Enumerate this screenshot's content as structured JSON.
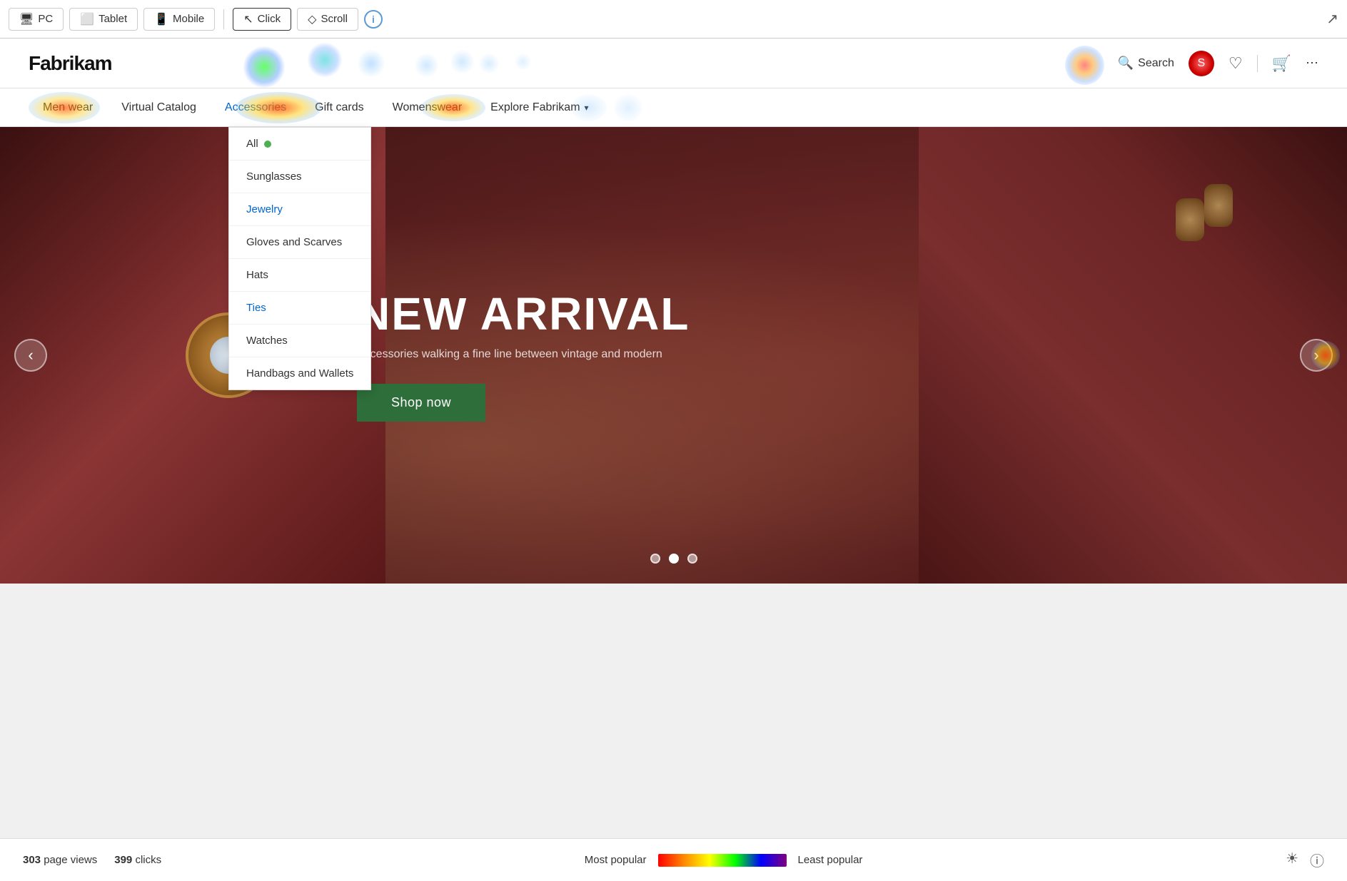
{
  "toolbar": {
    "buttons": [
      {
        "id": "pc",
        "icon": "🖥",
        "label": "PC"
      },
      {
        "id": "tablet",
        "icon": "📱",
        "label": "Tablet"
      },
      {
        "id": "mobile",
        "icon": "📱",
        "label": "Mobile"
      }
    ],
    "click_label": "Click",
    "scroll_label": "Scroll",
    "share_icon": "↗"
  },
  "site": {
    "logo": "Fabrikam",
    "search_label": "Search",
    "nav_items": [
      {
        "id": "menswear",
        "label": "Men wear",
        "active": false,
        "has_dropdown": false
      },
      {
        "id": "virtual-catalog",
        "label": "Virtual Catalog",
        "active": false,
        "has_dropdown": false
      },
      {
        "id": "accessories",
        "label": "Accessories",
        "active": true,
        "has_dropdown": false
      },
      {
        "id": "gift-cards",
        "label": "Gift cards",
        "active": false,
        "has_dropdown": false
      },
      {
        "id": "womenswear",
        "label": "Womenswear",
        "active": false,
        "has_dropdown": false
      },
      {
        "id": "explore",
        "label": "Explore Fabrikam",
        "active": false,
        "has_dropdown": true
      }
    ],
    "dropdown": {
      "items": [
        {
          "id": "all",
          "label": "All",
          "highlighted": false
        },
        {
          "id": "sunglasses",
          "label": "Sunglasses",
          "highlighted": false
        },
        {
          "id": "jewelry",
          "label": "Jewelry",
          "highlighted": true
        },
        {
          "id": "gloves-scarves",
          "label": "Gloves and Scarves",
          "highlighted": false
        },
        {
          "id": "hats",
          "label": "Hats",
          "highlighted": false
        },
        {
          "id": "ties",
          "label": "Ties",
          "highlighted": true
        },
        {
          "id": "watches",
          "label": "Watches",
          "highlighted": false
        },
        {
          "id": "handbags-wallets",
          "label": "Handbags and Wallets",
          "highlighted": false
        }
      ]
    }
  },
  "hero": {
    "tag": "NEW ARRIVAL",
    "description": "Accessories walking a fine line between vintage and modern",
    "shop_now_label": "Shop now",
    "dots": [
      {
        "active": false
      },
      {
        "active": true
      },
      {
        "active": false
      }
    ],
    "prev_label": "‹",
    "next_label": "›"
  },
  "footer": {
    "page_views_count": "303",
    "page_views_label": "page views",
    "clicks_count": "399",
    "clicks_label": "clicks",
    "most_popular_label": "Most popular",
    "least_popular_label": "Least popular"
  }
}
